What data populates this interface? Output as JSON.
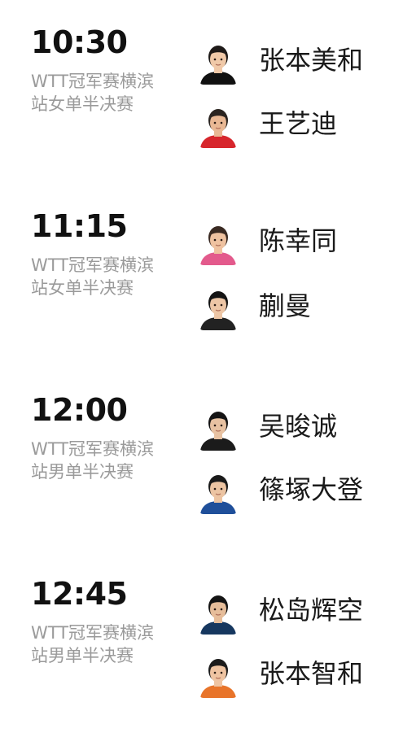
{
  "matches": [
    {
      "time": "10:30",
      "event": "WTT冠军赛横滨站女单半决赛",
      "players": [
        {
          "name": "张本美和",
          "avatar_icon": "player-avatar-icon",
          "skin": "#f0c9a8",
          "hair": "#1e1a18",
          "shirt": "#111111"
        },
        {
          "name": "王艺迪",
          "avatar_icon": "player-avatar-icon",
          "skin": "#e9b894",
          "hair": "#2a2420",
          "shirt": "#d7262c"
        }
      ]
    },
    {
      "time": "11:15",
      "event": "WTT冠军赛横滨站女单半决赛",
      "players": [
        {
          "name": "陈幸同",
          "avatar_icon": "player-avatar-icon",
          "skin": "#efc2a0",
          "hair": "#3a2a22",
          "shirt": "#e35a8c"
        },
        {
          "name": "蒯曼",
          "avatar_icon": "player-avatar-icon",
          "skin": "#edc6a6",
          "hair": "#141414",
          "shirt": "#222222"
        }
      ]
    },
    {
      "time": "12:00",
      "event": "WTT冠军赛横滨站男单半决赛",
      "players": [
        {
          "name": "吴晙诚",
          "avatar_icon": "player-avatar-icon",
          "skin": "#e8c2a2",
          "hair": "#141414",
          "shirt": "#1b1b1b"
        },
        {
          "name": "篠塚大登",
          "avatar_icon": "player-avatar-icon",
          "skin": "#ecc4a2",
          "hair": "#1a1a1a",
          "shirt": "#1f4f9a"
        }
      ]
    },
    {
      "time": "12:45",
      "event": "WTT冠军赛横滨站男单半决赛",
      "players": [
        {
          "name": "松岛辉空",
          "avatar_icon": "player-avatar-icon",
          "skin": "#e6bd9a",
          "hair": "#141414",
          "shirt": "#16375f"
        },
        {
          "name": "张本智和",
          "avatar_icon": "player-avatar-icon",
          "skin": "#efc4a2",
          "hair": "#1c1c1c",
          "shirt": "#e8742a"
        }
      ]
    }
  ]
}
